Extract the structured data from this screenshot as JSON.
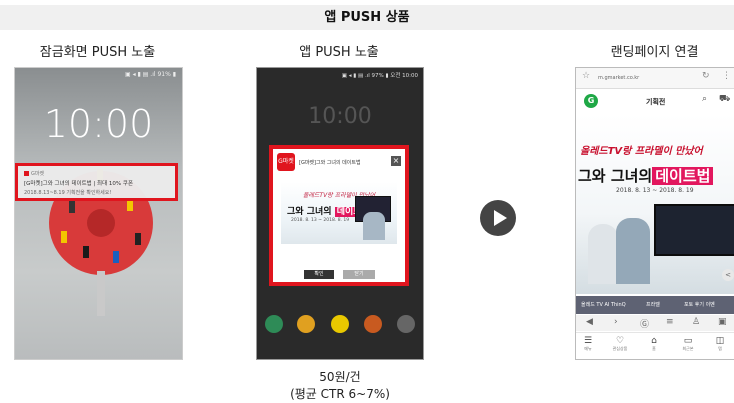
{
  "header": {
    "title": "앱 PUSH 상품"
  },
  "columns": {
    "lock_screen": {
      "label": "잠금화면 PUSH 노출"
    },
    "app_push": {
      "label": "앱 PUSH 노출"
    },
    "landing": {
      "label": "랜딩페이지 연결"
    }
  },
  "phone1": {
    "status": "▣ ◂ ▮ ▤ .ıl 91% ▮",
    "clock": "10:00",
    "notification": {
      "app": "G마켓",
      "title": "[G마켓]그와 그녀의 데이트법 | 최대 10% 쿠폰",
      "subtitle": "2018.8.13~8.19 기획전을 확인하세요!"
    }
  },
  "phone2": {
    "status": "▣ ◂ ▮ ▤ .ıl 97% ▮ 오전 10:00",
    "clock": "10:00",
    "popup": {
      "logo": "G마켓",
      "title": "[G마켓]그와 그녀의 데이트법",
      "close": "×",
      "banner_script": "올레드TV랑 프라델이 만났어",
      "banner_main_a": "그와 그녀의",
      "banner_main_b": "데이트법",
      "banner_date": "2018. 8. 13 ~ 2018. 8. 19",
      "ok": "확인",
      "cancel": "닫기"
    }
  },
  "phone3": {
    "url": "m.gmarket.co.kr",
    "logo": "G",
    "head_title": "기획전",
    "landing_script": "올레드TV랑 프라델이 만났어",
    "landing_main_a": "그와 그녀의",
    "landing_main_b": "데이트법",
    "landing_date": "2018. 8. 13 ~ 2018. 8. 19",
    "categories": [
      "올레드 TV AI ThinQ",
      "프라델",
      "포토 후기 이벤"
    ],
    "bottom": [
      {
        "icon": "☰",
        "label": "메뉴"
      },
      {
        "icon": "♡",
        "label": "관심상품"
      },
      {
        "icon": "⌂",
        "label": "홈"
      },
      {
        "icon": "▭",
        "label": "최근본"
      },
      {
        "icon": "◫",
        "label": "탭"
      }
    ]
  },
  "pricing": {
    "price": "50원/건",
    "ctr": "(평균 CTR 6~7%)"
  }
}
